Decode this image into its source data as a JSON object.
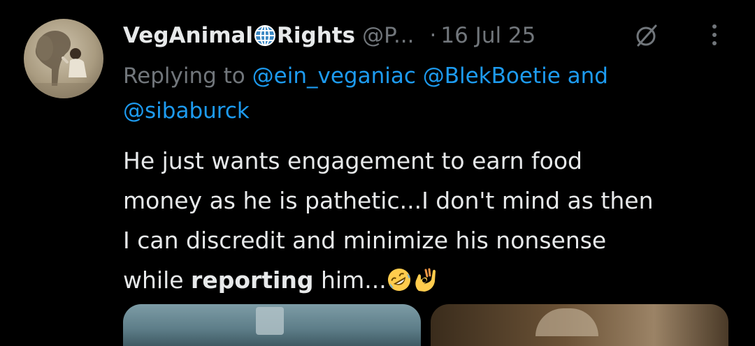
{
  "tweet": {
    "author": {
      "name_part1": "VegAnimal",
      "name_part2": "Rights",
      "name_icon": "globe-with-meridians-icon",
      "handle": "@P...",
      "avatar": "elephant-and-child-avatar"
    },
    "separator": "·",
    "date": "16 Jul 25",
    "grok_icon": "grok-icon",
    "more_icon": "more-vertical-icon",
    "replying": {
      "prefix": "Replying to",
      "mentions": [
        "@ein_veganiac",
        "@BlekBoetie"
      ],
      "conjunction": "and",
      "last_mention": "@sibaburck"
    },
    "text": {
      "line1": "He just wants engagement to earn food",
      "line2": "money as he is pathetic...I don't mind as then",
      "line3": "I can discredit and minimize his nonsense",
      "line4_prefix": "while",
      "line4_bold": "reporting",
      "line4_suffix": "him...",
      "emojis": [
        "rolling-on-floor-laughing-emoji",
        "ok-hand-emoji"
      ]
    },
    "media": [
      "media-image-1",
      "media-image-2"
    ]
  },
  "colors": {
    "background": "#000000",
    "text_primary": "#e7e9ea",
    "text_secondary": "#71767b",
    "link": "#1d9bf0"
  }
}
